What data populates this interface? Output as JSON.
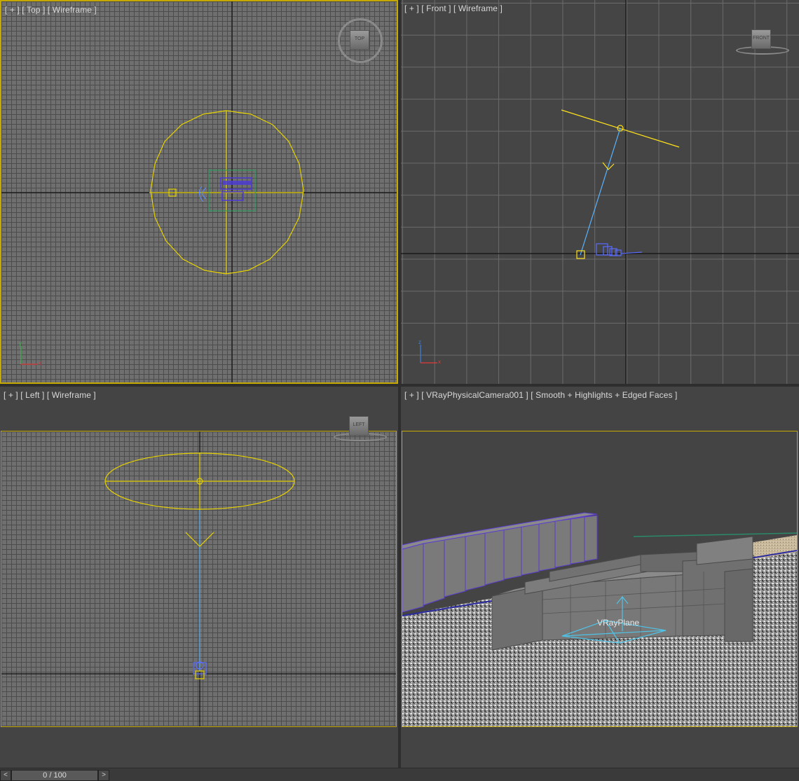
{
  "viewports": {
    "top": {
      "plus": "[ + ]",
      "view": "[ Top ]",
      "mode": "[ Wireframe ]",
      "cube_label": "TOP",
      "axis_x": "x",
      "axis_y": "y"
    },
    "front": {
      "plus": "[ + ]",
      "view": "[ Front ]",
      "mode": "[ Wireframe ]",
      "cube_label": "FRONT",
      "axis_x": "x",
      "axis_y": "z"
    },
    "left": {
      "plus": "[ + ]",
      "view": "[ Left ]",
      "mode": "[ Wireframe ]",
      "cube_label": "LEFT"
    },
    "camera": {
      "plus": "[ + ]",
      "view": "[ VRayPhysicalCamera001 ]",
      "mode": "[ Smooth + Highlights + Edged Faces ]",
      "object_label": "VRayPlane"
    }
  },
  "timeline": {
    "prev": "<",
    "frame": "0 / 100",
    "next": ">"
  },
  "colors": {
    "selection": "#e6d200",
    "light": "#ffe21a",
    "target_line": "#5ab4ff",
    "vray_plane": "#4fc3e6",
    "camera": "#5a6cff",
    "viewport_bg": "#444444"
  }
}
